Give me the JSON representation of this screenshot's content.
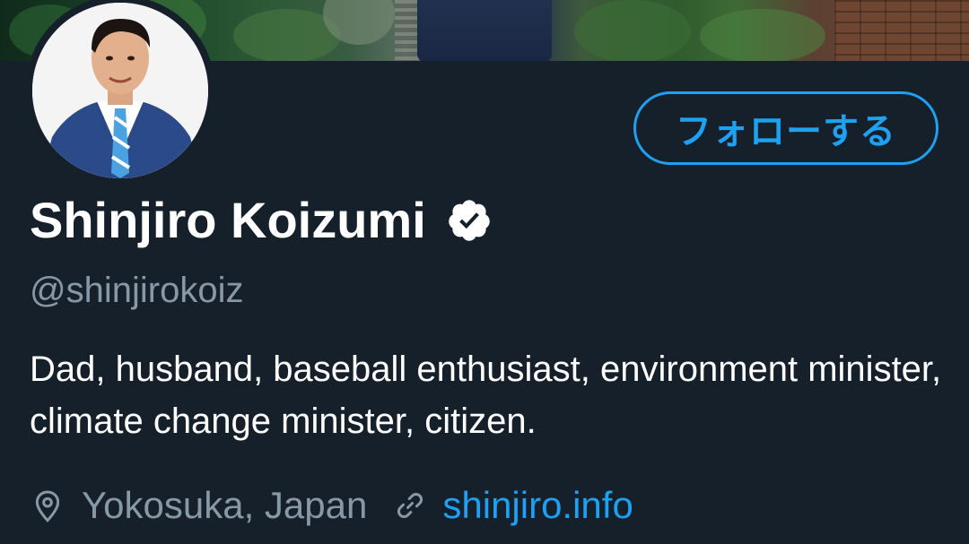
{
  "profile": {
    "display_name": "Shinjiro Koizumi",
    "handle": "@shinjirokoiz",
    "bio": "Dad, husband, baseball enthusiast, environment minister, climate change minister, citizen.",
    "location": "Yokosuka, Japan",
    "website": "shinjiro.info",
    "verified": true
  },
  "actions": {
    "follow_label": "フォローする"
  },
  "icons": {
    "verified": "verified-badge-icon",
    "location": "location-pin-icon",
    "link": "link-icon"
  },
  "colors": {
    "background": "#15202b",
    "accent": "#1da1f2",
    "secondary_text": "#8899a6",
    "primary_text": "#ffffff"
  }
}
